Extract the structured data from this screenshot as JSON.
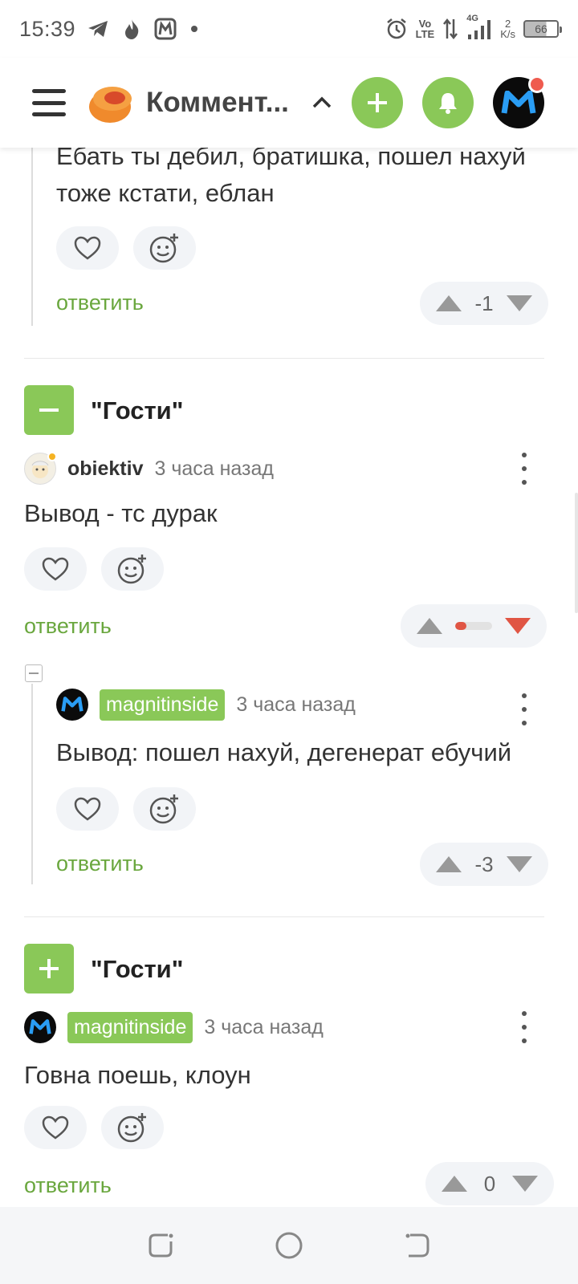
{
  "status_bar": {
    "time": "15:39",
    "left_icons": [
      "telegram-icon",
      "fire-icon",
      "magnit-icon",
      "dot-icon"
    ],
    "volte": "Vo\nLTE",
    "network": "4G",
    "speed_value": "2",
    "speed_unit": "K/s",
    "battery": "66"
  },
  "header": {
    "title": "Комментарии",
    "title_display": "Коммент...",
    "accent_color": "#8ac858"
  },
  "comments": [
    {
      "text": "Ебать ты дебил, братишка, пошел нахуй тоже кстати, еблан",
      "reply_label": "ответить",
      "rating": "-1"
    },
    {
      "group_title": "\"Гости\"",
      "username": "obiektiv",
      "time": "3 часа назад",
      "text": "Вывод - тс дурак",
      "reply_label": "ответить",
      "rating_fraction": 0.3
    },
    {
      "username": "magnitinside",
      "time": "3 часа назад",
      "text": "Вывод: пошел нахуй, дегенерат ебучий",
      "reply_label": "ответить",
      "rating": "-3"
    },
    {
      "group_title": "\"Гости\"",
      "username": "magnitinside",
      "time": "3 часа назад",
      "text": "Говна поешь, клоун",
      "reply_label": "ответить",
      "rating": "0"
    }
  ]
}
